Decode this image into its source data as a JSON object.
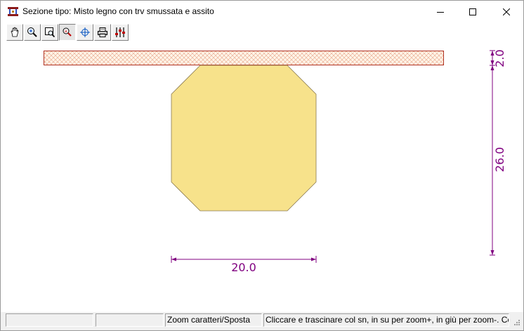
{
  "window": {
    "title": "Sezione tipo: Misto legno con trv smussata e assito",
    "controls": {
      "minimize": "minimize-icon",
      "maximize": "maximize-icon",
      "close": "close-icon"
    }
  },
  "toolbar": {
    "buttons": [
      {
        "icon": "hand-pan-icon",
        "pressed": false
      },
      {
        "icon": "zoom-in-icon",
        "pressed": false
      },
      {
        "icon": "zoom-window-icon",
        "pressed": false
      },
      {
        "icon": "zoom-text-icon",
        "pressed": true
      },
      {
        "icon": "crosshair-icon",
        "pressed": false
      },
      {
        "icon": "printer-icon",
        "pressed": false
      },
      {
        "icon": "settings-icon",
        "pressed": false
      }
    ]
  },
  "drawing": {
    "dimensions": {
      "deck_thickness": "2.0",
      "beam_height": "26.0",
      "beam_width": "20.0"
    },
    "colors": {
      "beam_fill": "#F7E28B",
      "deck_fill": "#FFF5E8",
      "hatch": "#E8A58A",
      "outline": "#B03020",
      "dimension": "#800080"
    }
  },
  "statusbar": {
    "panel1": "",
    "panel2": "",
    "panel3": "Zoom caratteri/Sposta",
    "panel4": "Cliccare e trascinare col sn, in su per zoom+, in giù per zoom-. Col ds per s"
  }
}
